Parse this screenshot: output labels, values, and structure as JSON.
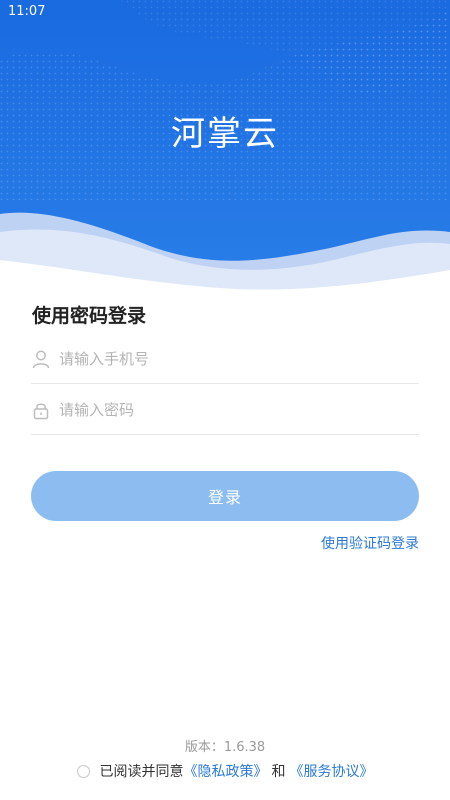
{
  "status_bar": {
    "time": "11:07"
  },
  "app": {
    "title": "河掌云"
  },
  "form": {
    "title": "使用密码登录",
    "phone_placeholder": "请输入手机号",
    "password_placeholder": "请输入密码",
    "login_label": "登录",
    "sms_login_link": "使用验证码登录"
  },
  "footer": {
    "version": "版本：1.6.38",
    "agree_prefix": "已阅读并同意",
    "privacy_link": "《隐私政策》",
    "and": "和",
    "service_link": "《服务协议》"
  },
  "icons": {
    "phone": "user-icon",
    "password": "lock-icon"
  },
  "colors": {
    "primary": "#1a6fe0",
    "button": "#8dbdf0",
    "link": "#2b7ad6"
  }
}
